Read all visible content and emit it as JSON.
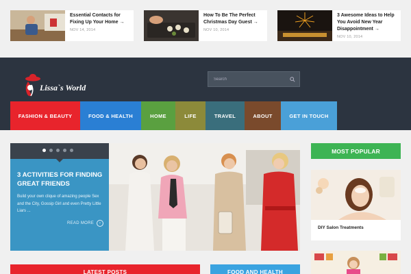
{
  "featured": [
    {
      "title": "Essential Contacts for Fixing Up Your Home →",
      "date": "NOV 14, 2014"
    },
    {
      "title": "How To Be The Perfect Christmas Day Guest →",
      "date": "NOV 10, 2014"
    },
    {
      "title": "3 Awesome Ideas to Help You Avoid New Year Disappointment →",
      "date": "NOV 10, 2014"
    }
  ],
  "header": {
    "logo_text": "Lissa`s World",
    "search_placeholder": "Search"
  },
  "nav": [
    {
      "label": "FASHION & BEAUTY",
      "color": "#e8242c"
    },
    {
      "label": "FOOD & HEALTH",
      "color": "#2a7fd4"
    },
    {
      "label": "HOME",
      "color": "#5aa040"
    },
    {
      "label": "LIFE",
      "color": "#8c8a3a"
    },
    {
      "label": "TRAVEL",
      "color": "#3a6e7c"
    },
    {
      "label": "ABOUT",
      "color": "#7a4a2c"
    },
    {
      "label": "GET IN TOUCH",
      "color": "#4aa0d8"
    }
  ],
  "hero": {
    "title": "3 ACTIVITIES FOR FINDING GREAT FRIENDS",
    "excerpt": "Build your own clique of amazing people Sex and the City, Gossip Girl and even Pretty Little Liars ...",
    "read_more": "READ MORE",
    "read_more_arrow": "›",
    "slides": 5,
    "active_slide": 1
  },
  "sidebar": {
    "heading": "MOST POPULAR",
    "popular_title": "DIY Salon Treatments"
  },
  "sections": {
    "latest_posts": "LATEST POSTS",
    "food_and_health": "FOOD AND HEALTH"
  },
  "colors": {
    "header_bg": "#2c3440",
    "hero_panel": "#3a95c4",
    "popular_green": "#3db454",
    "latest_red": "#e8242c",
    "food_blue": "#3aa3e0"
  }
}
